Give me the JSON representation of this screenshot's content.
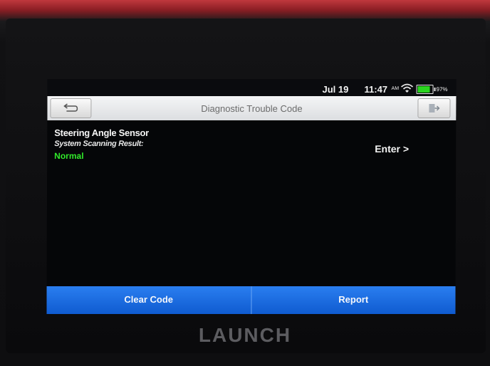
{
  "status_bar": {
    "date": "Jul 19",
    "time": "11:47",
    "ampm": "AM",
    "battery_percent": "97%",
    "battery_level": 0.97
  },
  "header": {
    "title": "Diagnostic Trouble Code"
  },
  "result": {
    "system_name": "Steering Angle Sensor",
    "scan_label": "System Scanning Result:",
    "status": "Normal",
    "enter_label": "Enter >"
  },
  "footer": {
    "clear_code_label": "Clear Code",
    "report_label": "Report"
  },
  "device": {
    "brand": "LAUNCH"
  },
  "colors": {
    "status_ok": "#31e82a",
    "button_blue": "#1263d9"
  }
}
